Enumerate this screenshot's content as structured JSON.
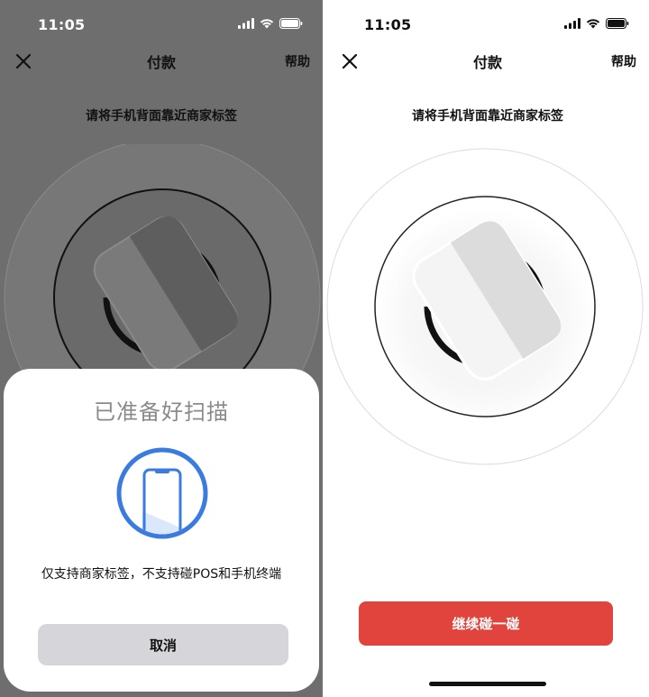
{
  "left_screen": {
    "status": {
      "time": "11:05"
    },
    "nav": {
      "title": "付款",
      "help": "帮助"
    },
    "instruction": "请将手机背面靠近商家标签",
    "sheet": {
      "title": "已准备好扫描",
      "description": "仅支持商家标签，不支持碰POS和手机终端",
      "cancel_label": "取消"
    }
  },
  "right_screen": {
    "status": {
      "time": "11:05"
    },
    "nav": {
      "title": "付款",
      "help": "帮助"
    },
    "instruction": "请将手机背面靠近商家标签",
    "continue_label": "继续碰一碰"
  },
  "colors": {
    "accent_red": "#e0443c",
    "scan_blue": "#3a7be0",
    "dim_background": "#6e6e6e"
  },
  "icons": [
    "close-icon",
    "signal-icon",
    "wifi-icon",
    "battery-icon",
    "nfc-phone-icon",
    "phone-scan-icon"
  ]
}
